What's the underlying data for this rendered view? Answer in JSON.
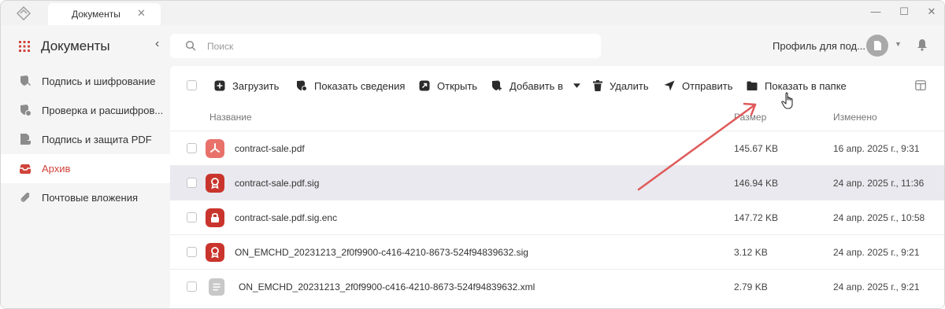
{
  "titlebar": {
    "tab_label": "Документы",
    "tab_close": "✕",
    "minimize": "—",
    "maximize": "☐",
    "close": "✕"
  },
  "sidebar": {
    "title": "Документы",
    "collapse": "‹",
    "items": [
      {
        "label": "Подпись и шифрование",
        "icon": "shield-pen-icon"
      },
      {
        "label": "Проверка и расшифров...",
        "icon": "shield-check-icon"
      },
      {
        "label": "Подпись и защита PDF",
        "icon": "pdf-shield-icon"
      },
      {
        "label": "Архив",
        "icon": "archive-icon",
        "active": true
      },
      {
        "label": "Почтовые вложения",
        "icon": "paperclip-icon"
      }
    ]
  },
  "search": {
    "placeholder": "Поиск",
    "value": ""
  },
  "profile": {
    "label": "Профиль для под...",
    "caret": "▼"
  },
  "toolbar": {
    "upload": "Загрузить",
    "show_info": "Показать сведения",
    "open": "Открыть",
    "add_to": "Добавить в",
    "delete": "Удалить",
    "send": "Отправить",
    "show_in_folder": "Показать в папке"
  },
  "table": {
    "columns": {
      "name": "Название",
      "size": "Размер",
      "modified": "Изменено"
    },
    "rows": [
      {
        "name": "contract-sale.pdf",
        "size": "145.67 KB",
        "modified": "16 апр. 2025 г., 9:31",
        "type": "pdf",
        "color": "#e8716a"
      },
      {
        "name": "contract-sale.pdf.sig",
        "size": "146.94 KB",
        "modified": "24 апр. 2025 г., 11:36",
        "type": "sig",
        "color": "#c9352c",
        "selected": true
      },
      {
        "name": "contract-sale.pdf.sig.enc",
        "size": "147.72 KB",
        "modified": "24 апр. 2025 г., 10:58",
        "type": "enc",
        "color": "#c9352c"
      },
      {
        "name": "ON_EMCHD_20231213_2f0f9900-c416-4210-8673-524f94839632.sig",
        "size": "3.12 KB",
        "modified": "24 апр. 2025 г., 9:21",
        "type": "sig",
        "color": "#c9352c"
      },
      {
        "name": "ON_EMCHD_20231213_2f0f9900-c416-4210-8673-524f94839632.xml",
        "size": "2.79 KB",
        "modified": "24 апр. 2025 г., 9:21",
        "type": "xml",
        "color": "#c8c8c8"
      }
    ]
  },
  "colors": {
    "accent": "#d0433b",
    "annotation_arrow": "#e05a5a",
    "selected_row": "#e9e9ef"
  }
}
